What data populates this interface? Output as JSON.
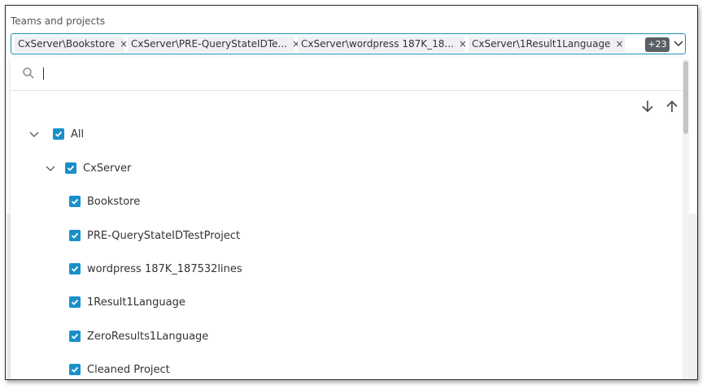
{
  "field": {
    "label": "Teams and projects",
    "chips": [
      {
        "label": "CxServer\\Bookstore",
        "remove": "×"
      },
      {
        "label": "CxServer\\PRE-QueryStateIDTe...",
        "remove": "×"
      },
      {
        "label": "CxServer\\wordpress 187K_18...",
        "remove": "×"
      },
      {
        "label": "CxServer\\1Result1Language",
        "remove": "×"
      }
    ],
    "more_count": "+23"
  },
  "search": {
    "value": "",
    "placeholder": ""
  },
  "tree": {
    "root": {
      "label": "All",
      "checked": true,
      "expanded": true
    },
    "group": {
      "label": "CxServer",
      "checked": true,
      "expanded": true
    },
    "projects": [
      {
        "label": "Bookstore",
        "checked": true
      },
      {
        "label": "PRE-QueryStateIDTestProject",
        "checked": true
      },
      {
        "label": "wordpress 187K_187532lines",
        "checked": true
      },
      {
        "label": "1Result1Language",
        "checked": true
      },
      {
        "label": "ZeroResults1Language",
        "checked": true
      },
      {
        "label": "Cleaned Project",
        "checked": true
      }
    ]
  },
  "colors": {
    "accent": "#1a8fc9",
    "focus_border": "#1f8fb8",
    "badge_bg": "#5a5f66"
  }
}
